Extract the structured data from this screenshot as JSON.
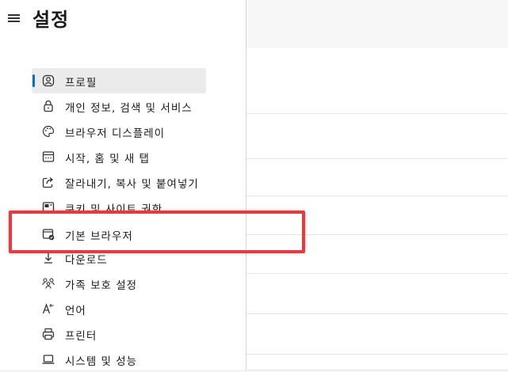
{
  "header": {
    "title": "설정"
  },
  "sidebar": {
    "items": [
      {
        "label": "프로필",
        "icon": "profile-icon",
        "selected": true
      },
      {
        "label": "개인 정보, 검색 및 서비스",
        "icon": "lock-icon"
      },
      {
        "label": "브라우저 디스플레이",
        "icon": "palette-icon"
      },
      {
        "label": "시작, 홈 및 새 탭",
        "icon": "start-page-icon"
      },
      {
        "label": "잘라내기, 복사 및 붙여넣기",
        "icon": "share-icon"
      },
      {
        "label": "쿠키 및 사이트 권한",
        "icon": "cookie-icon"
      },
      {
        "label": "기본 브라우저",
        "icon": "default-browser-icon"
      },
      {
        "label": "다운로드",
        "icon": "download-icon"
      },
      {
        "label": "가족 보호 설정",
        "icon": "family-icon"
      },
      {
        "label": "언어",
        "icon": "language-icon"
      },
      {
        "label": "프린터",
        "icon": "printer-icon"
      },
      {
        "label": "시스템 및 성능",
        "icon": "laptop-icon"
      }
    ]
  },
  "colors": {
    "accent": "#0f6cbd",
    "highlight": "#e63a3f"
  }
}
